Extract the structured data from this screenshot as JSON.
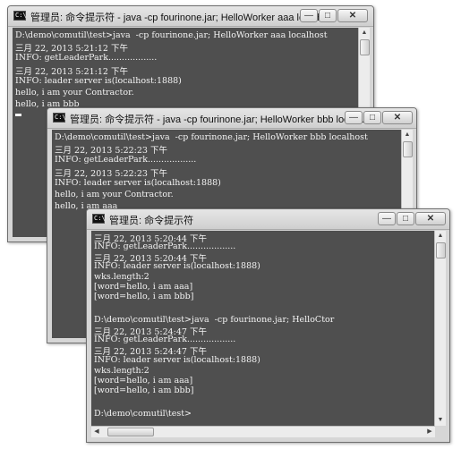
{
  "windows": [
    {
      "title": "管理员: 命令提示符 - java  -cp fourinone.jar; HelloWorker aaa localh...",
      "icon": "cmd-icon",
      "lines": [
        "D:\\demo\\comutil\\test>java  -cp fourinone.jar; HelloWorker aaa localhost",
        "三月 22, 2013 5:21:12 下午",
        "INFO: getLeaderPark..................",
        "三月 22, 2013 5:21:12 下午",
        "INFO: leader server is(localhost:1888)",
        "hello, i am your Contractor.",
        "hello, i am bbb"
      ]
    },
    {
      "title": "管理员: 命令提示符 - java  -cp fourinone.jar; HelloWorker bbb local...",
      "icon": "cmd-icon",
      "lines": [
        "D:\\demo\\comutil\\test>java  -cp fourinone.jar; HelloWorker bbb localhost",
        "三月 22, 2013 5:22:23 下午",
        "INFO: getLeaderPark..................",
        "三月 22, 2013 5:22:23 下午",
        "INFO: leader server is(localhost:1888)",
        "hello, i am your Contractor.",
        "hello, i am aaa"
      ]
    },
    {
      "title": "管理员: 命令提示符",
      "icon": "cmd-icon",
      "lines": [
        "三月 22, 2013 5:20:44 下午",
        "INFO: getLeaderPark..................",
        "三月 22, 2013 5:20:44 下午",
        "INFO: leader server is(localhost:1888)",
        "wks.length:2",
        "[word=hello, i am aaa]",
        "[word=hello, i am bbb]",
        "",
        "D:\\demo\\comutil\\test>java  -cp fourinone.jar; HelloCtor",
        "三月 22, 2013 5:24:47 下午",
        "INFO: getLeaderPark..................",
        "三月 22, 2013 5:24:47 下午",
        "INFO: leader server is(localhost:1888)",
        "wks.length:2",
        "[word=hello, i am aaa]",
        "[word=hello, i am bbb]",
        "",
        "D:\\demo\\comutil\\test>"
      ]
    }
  ],
  "controls": {
    "minimize": "—",
    "maximize": "□",
    "close": "✕"
  }
}
